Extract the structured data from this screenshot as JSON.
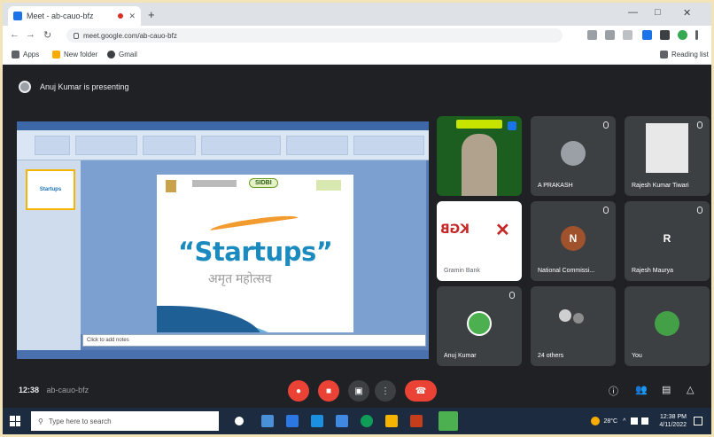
{
  "browser": {
    "tab_title": "Meet - ab-cauo-bfz",
    "omnibox_url": "meet.google.com/ab-cauo-bfz",
    "bookmarks": [
      "Apps",
      "New folder",
      "Gmail"
    ],
    "reading_list": "Reading list",
    "new_tab": "+",
    "back": "←",
    "forward": "→",
    "reload": "↻",
    "minimize": "—",
    "maximize": "□",
    "close": "✕"
  },
  "meet": {
    "presenter_label": "Anuj Kumar is presenting",
    "time": "12:38",
    "meeting_code": "ab-cauo-bfz",
    "participants": [
      {
        "name": "",
        "initial": "",
        "color": "#4caf50"
      },
      {
        "name": "A PRAKASH",
        "initial": "",
        "color": "#9aa0a6"
      },
      {
        "name": "Rajesh Kumar Tiwari",
        "initial": "",
        "color": "#e0e0e0"
      },
      {
        "name": "Gramin Bank",
        "initial": "",
        "color": "#ffffff"
      },
      {
        "name": "National Commissi...",
        "initial": "N",
        "color": "#a0522d"
      },
      {
        "name": "Rajesh Maurya",
        "initial": "R",
        "color": "#3c4043"
      },
      {
        "name": "Anuj Kumar",
        "initial": "",
        "color": "#4caf50"
      },
      {
        "name": "24 others",
        "initial": "",
        "color": "#3c4043"
      },
      {
        "name": "You",
        "initial": "",
        "color": "#43a047"
      }
    ]
  },
  "slide": {
    "main_text": "“Startups”",
    "sub_text": "अमृत महोत्सव",
    "badge": "SIDBI",
    "thumb_text": "Startups",
    "notes_placeholder": "Click to add notes"
  },
  "taskbar": {
    "search_placeholder": "Type here to search",
    "weather": "28°C",
    "clock_time": "12:38 PM",
    "clock_date": "4/11/2022"
  },
  "colors": {
    "meet_bg": "#202124",
    "end_call": "#ea4335",
    "tile_bg": "#3c4043"
  }
}
